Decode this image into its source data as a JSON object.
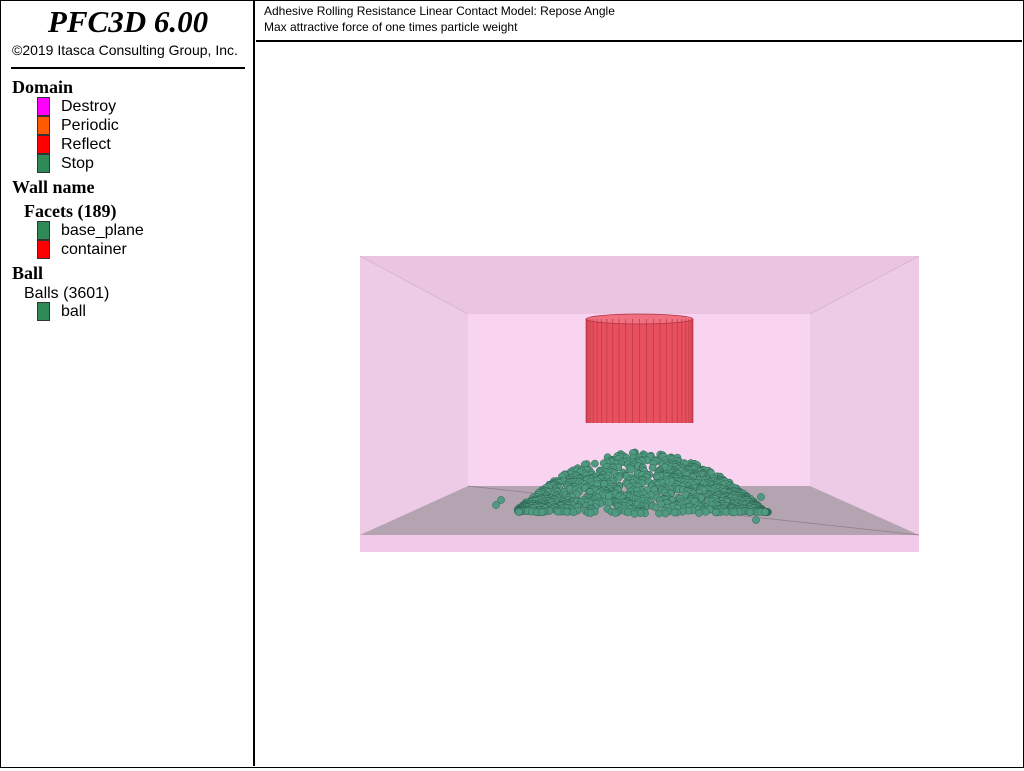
{
  "app": {
    "name": "PFC3D 6.00",
    "copyright": "©2019 Itasca Consulting Group, Inc."
  },
  "plot": {
    "title_line1": "Adhesive Rolling Resistance Linear Contact Model: Repose Angle",
    "title_line2": "Max attractive force of one times particle weight"
  },
  "legend": {
    "domain": {
      "heading": "Domain",
      "items": [
        {
          "label": "Destroy",
          "color": "#ff00ff"
        },
        {
          "label": "Periodic",
          "color": "#ff5a00"
        },
        {
          "label": "Reflect",
          "color": "#ff0000"
        },
        {
          "label": "Stop",
          "color": "#2e8b57"
        }
      ]
    },
    "wall": {
      "heading": "Wall name",
      "subheading": "Facets (189)",
      "items": [
        {
          "label": "base_plane",
          "color": "#2e8b57"
        },
        {
          "label": "container",
          "color": "#ff0000"
        }
      ]
    },
    "ball": {
      "heading": "Ball",
      "subheading": "Balls (3601)",
      "items": [
        {
          "label": "ball",
          "color": "#2e8b57"
        }
      ]
    }
  },
  "colors": {
    "domain_box": "#f7cdef",
    "floor": "#a89aa5",
    "container": "#e8505f",
    "ball": "#4f9a80"
  }
}
